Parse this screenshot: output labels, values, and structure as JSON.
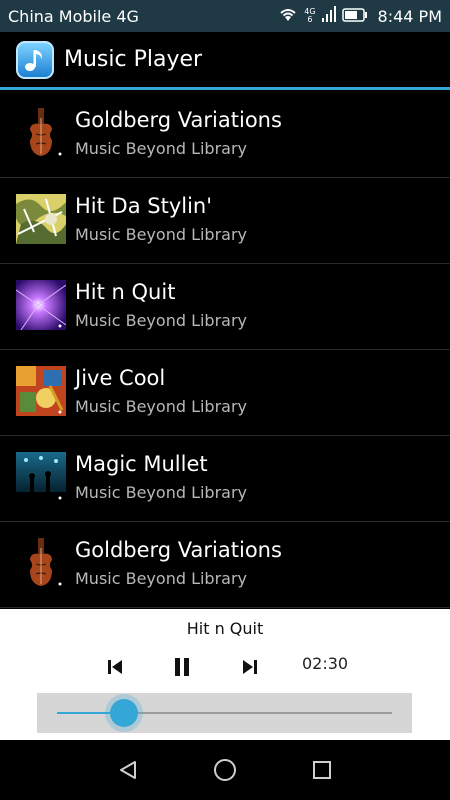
{
  "status": {
    "carrier": "China Mobile 4G",
    "network_top": "4G",
    "network_bottom": "6",
    "time": "8:44 PM",
    "icons": [
      "wifi-icon",
      "signal-icon",
      "battery-icon"
    ]
  },
  "app": {
    "title": "Music Player",
    "icon": "music-note-icon"
  },
  "tracks": [
    {
      "title": "Goldberg Variations",
      "artist": "Music Beyond Library",
      "art": "violin"
    },
    {
      "title": "Hit Da Stylin'",
      "artist": "Music Beyond Library",
      "art": "graffiti"
    },
    {
      "title": "Hit n Quit",
      "artist": "Music Beyond Library",
      "art": "light"
    },
    {
      "title": "Jive Cool",
      "artist": "Music Beyond Library",
      "art": "collage"
    },
    {
      "title": "Magic Mullet",
      "artist": "Music Beyond Library",
      "art": "concert"
    },
    {
      "title": "Goldberg Variations",
      "artist": "Music Beyond Library",
      "art": "violin"
    }
  ],
  "player": {
    "now_playing": "Hit n Quit",
    "time": "02:30",
    "progress": 0.2,
    "controls": [
      "previous-icon",
      "pause-icon",
      "next-icon"
    ]
  },
  "nav": [
    "back-icon",
    "home-icon",
    "recents-icon"
  ],
  "colors": {
    "accent": "#35a7d6",
    "status_bar": "#1f3a45"
  }
}
